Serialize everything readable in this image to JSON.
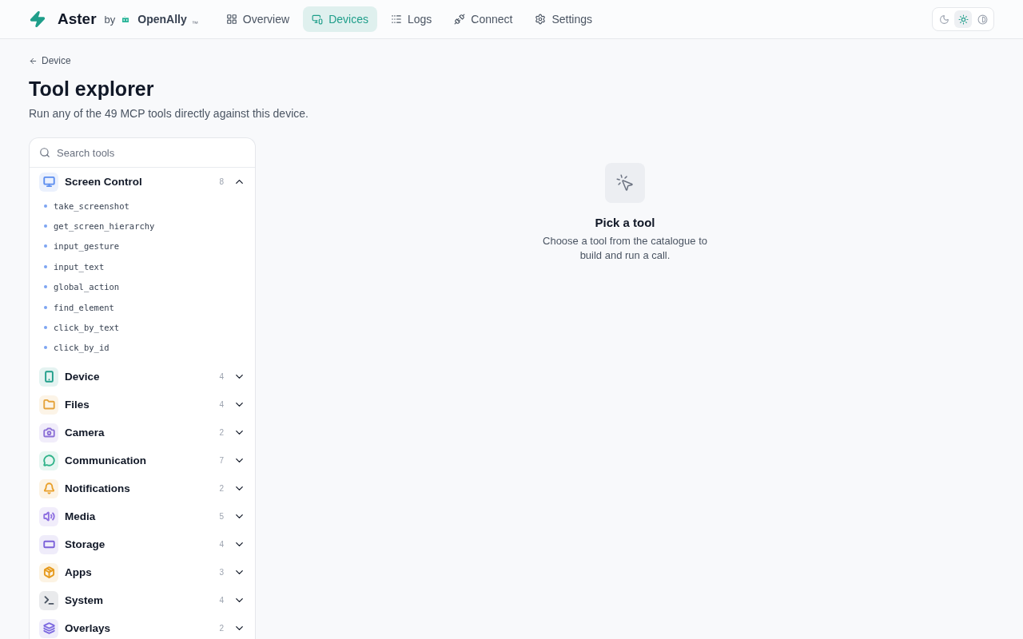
{
  "brand": {
    "name": "Aster",
    "by": "by",
    "company": "OpenAlly",
    "trademark": "™"
  },
  "nav": [
    {
      "label": "Overview",
      "selected": false
    },
    {
      "label": "Devices",
      "selected": true
    },
    {
      "label": "Logs",
      "selected": false
    },
    {
      "label": "Connect",
      "selected": false
    },
    {
      "label": "Settings",
      "selected": false
    }
  ],
  "theme_switcher": [
    {
      "kind": "dark",
      "selected": false
    },
    {
      "kind": "light",
      "selected": true
    },
    {
      "kind": "system",
      "selected": false
    }
  ],
  "breadcrumb": "Device",
  "title": "Tool explorer",
  "subtitle": "Run any of the 49 MCP tools directly against this device.",
  "search": {
    "placeholder": "Search tools"
  },
  "categories": [
    {
      "name": "Screen Control",
      "count": "8",
      "expanded": true,
      "color": "#5b8def",
      "tools": [
        "take_screenshot",
        "get_screen_hierarchy",
        "input_gesture",
        "input_text",
        "global_action",
        "find_element",
        "click_by_text",
        "click_by_id"
      ]
    },
    {
      "name": "Device",
      "count": "4",
      "expanded": false,
      "color": "#1f9e8a"
    },
    {
      "name": "Files",
      "count": "4",
      "expanded": false,
      "color": "#e5a23a"
    },
    {
      "name": "Camera",
      "count": "2",
      "expanded": false,
      "color": "#8b6fd6"
    },
    {
      "name": "Communication",
      "count": "7",
      "expanded": false,
      "color": "#2fb389"
    },
    {
      "name": "Notifications",
      "count": "2",
      "expanded": false,
      "color": "#e9a02b"
    },
    {
      "name": "Media",
      "count": "5",
      "expanded": false,
      "color": "#8e6fe0"
    },
    {
      "name": "Storage",
      "count": "4",
      "expanded": false,
      "color": "#7c62d9"
    },
    {
      "name": "Apps",
      "count": "3",
      "expanded": false,
      "color": "#e69a1c"
    },
    {
      "name": "System",
      "count": "4",
      "expanded": false,
      "color": "#4b5563"
    },
    {
      "name": "Overlays",
      "count": "2",
      "expanded": false,
      "color": "#7d6ae0"
    }
  ],
  "empty_state": {
    "title": "Pick a tool",
    "text": "Choose a tool from the catalogue to build and run a call."
  }
}
